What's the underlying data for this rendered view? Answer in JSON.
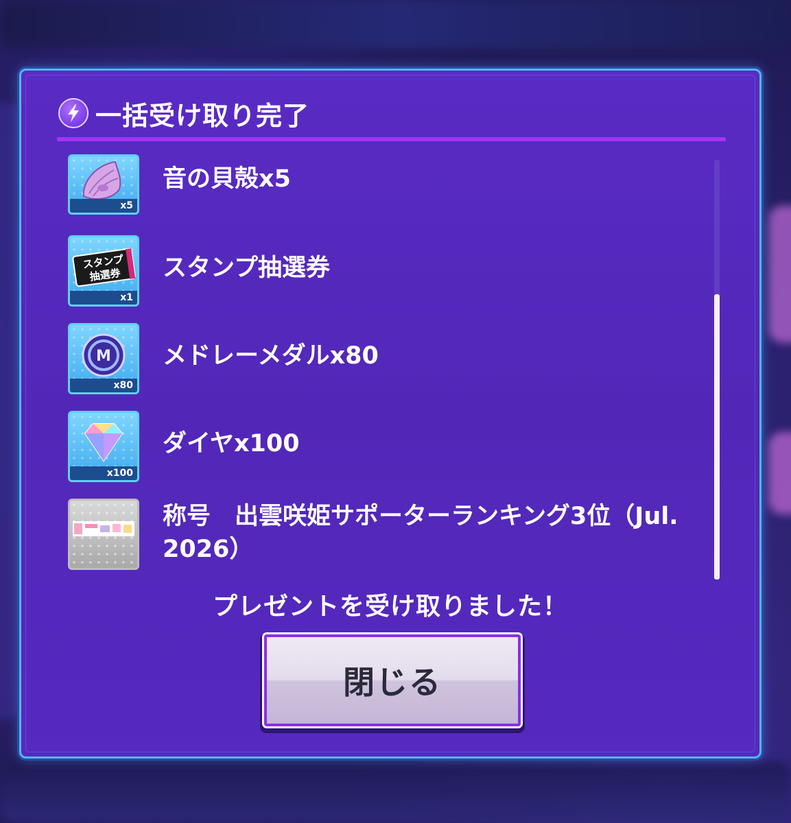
{
  "dialog": {
    "title": "一括受け取り完了",
    "title_icon": "lightning-bolt-icon",
    "accent_color": "#a434f0",
    "border_color": "#4fb8f0",
    "background_color": "#5a2bc4"
  },
  "items": [
    {
      "name": "音の貝殻x5",
      "count_badge": "x5",
      "icon": "seashell-icon"
    },
    {
      "name": "スタンプ抽選券",
      "count_badge": "x1",
      "icon": "stamp-ticket-icon"
    },
    {
      "name": "メドレーメダルx80",
      "count_badge": "x80",
      "icon": "medley-medal-icon"
    },
    {
      "name": "ダイヤx100",
      "count_badge": "x100",
      "icon": "diamond-icon"
    },
    {
      "name": "称号　出雲咲姫サポーターランキング3位（Jul. 2026）",
      "count_badge": "",
      "icon": "title-banner-icon"
    }
  ],
  "ticket_art_text": {
    "line1": "スタンプ",
    "line2": "抽選券"
  },
  "message": "プレゼントを受け取りました！",
  "close_button": {
    "label": "閉じる"
  }
}
